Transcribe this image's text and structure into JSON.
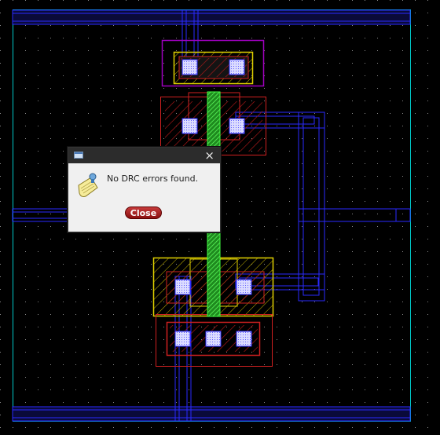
{
  "dialog": {
    "close_glyph": "×",
    "message": "No DRC errors found.",
    "button_label": "Close",
    "icon": "note-pin-icon",
    "window_icon": "window-icon"
  },
  "layout_view": {
    "background_color": "#000000",
    "grid_dot_color": "#8a8a8a",
    "metal1_color": "#2a2aff",
    "poly_color": "#40ff40",
    "diffusion_color": "#d02020",
    "nwell_color": "#e0d000",
    "boundary_color": "#a000c0",
    "cell_bound_color": "#00c8c8"
  }
}
